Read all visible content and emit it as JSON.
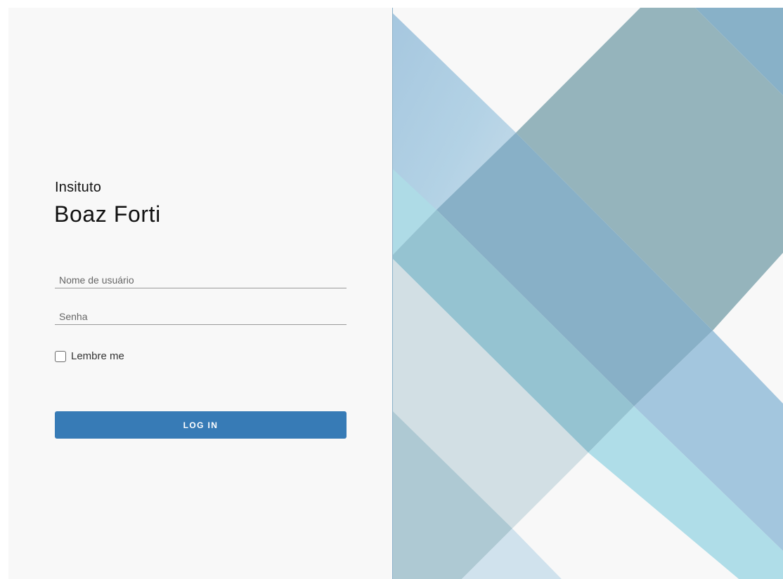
{
  "brand": {
    "subtitle": "Insituto",
    "title": "Boaz Forti"
  },
  "form": {
    "username_placeholder": "Nome de usuário",
    "username_value": "",
    "password_placeholder": "Senha",
    "password_value": "",
    "remember_label": "Lembre me",
    "remember_checked": false,
    "login_label": "LOG IN"
  },
  "colors": {
    "button": "#377bb6",
    "background": "#f8f8f8"
  }
}
